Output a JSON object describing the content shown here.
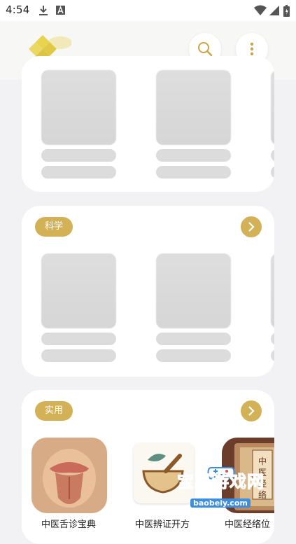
{
  "status_bar": {
    "time": "4:54",
    "icons": [
      "download-icon",
      "text-a-icon",
      "wifi-icon",
      "cell-signal-icon",
      "battery-icon"
    ]
  },
  "header": {
    "logo_icon": "diamond-logo-icon",
    "search_icon": "search-icon",
    "more_icon": "more-vertical-icon"
  },
  "sections": [
    {
      "tag": "",
      "placeholder_items": 3
    },
    {
      "tag": "科学",
      "placeholder_items": 3,
      "arrow_icon": "chevron-right-icon"
    },
    {
      "tag": "实用",
      "arrow_icon": "chevron-right-icon",
      "apps": [
        {
          "name": "中医舌诊宝典",
          "icon": "tongue-icon"
        },
        {
          "name": "中医辨证开方",
          "icon": "mortar-herb-icon"
        },
        {
          "name": "中医经络位",
          "icon": "meridian-book-icon"
        }
      ]
    }
  ],
  "watermark": {
    "text": "宝贝游戏网",
    "url": "baobeiy.com"
  },
  "colors": {
    "accent": "#d3b157",
    "card": "#ffffff",
    "background": "#f2f2f4"
  }
}
